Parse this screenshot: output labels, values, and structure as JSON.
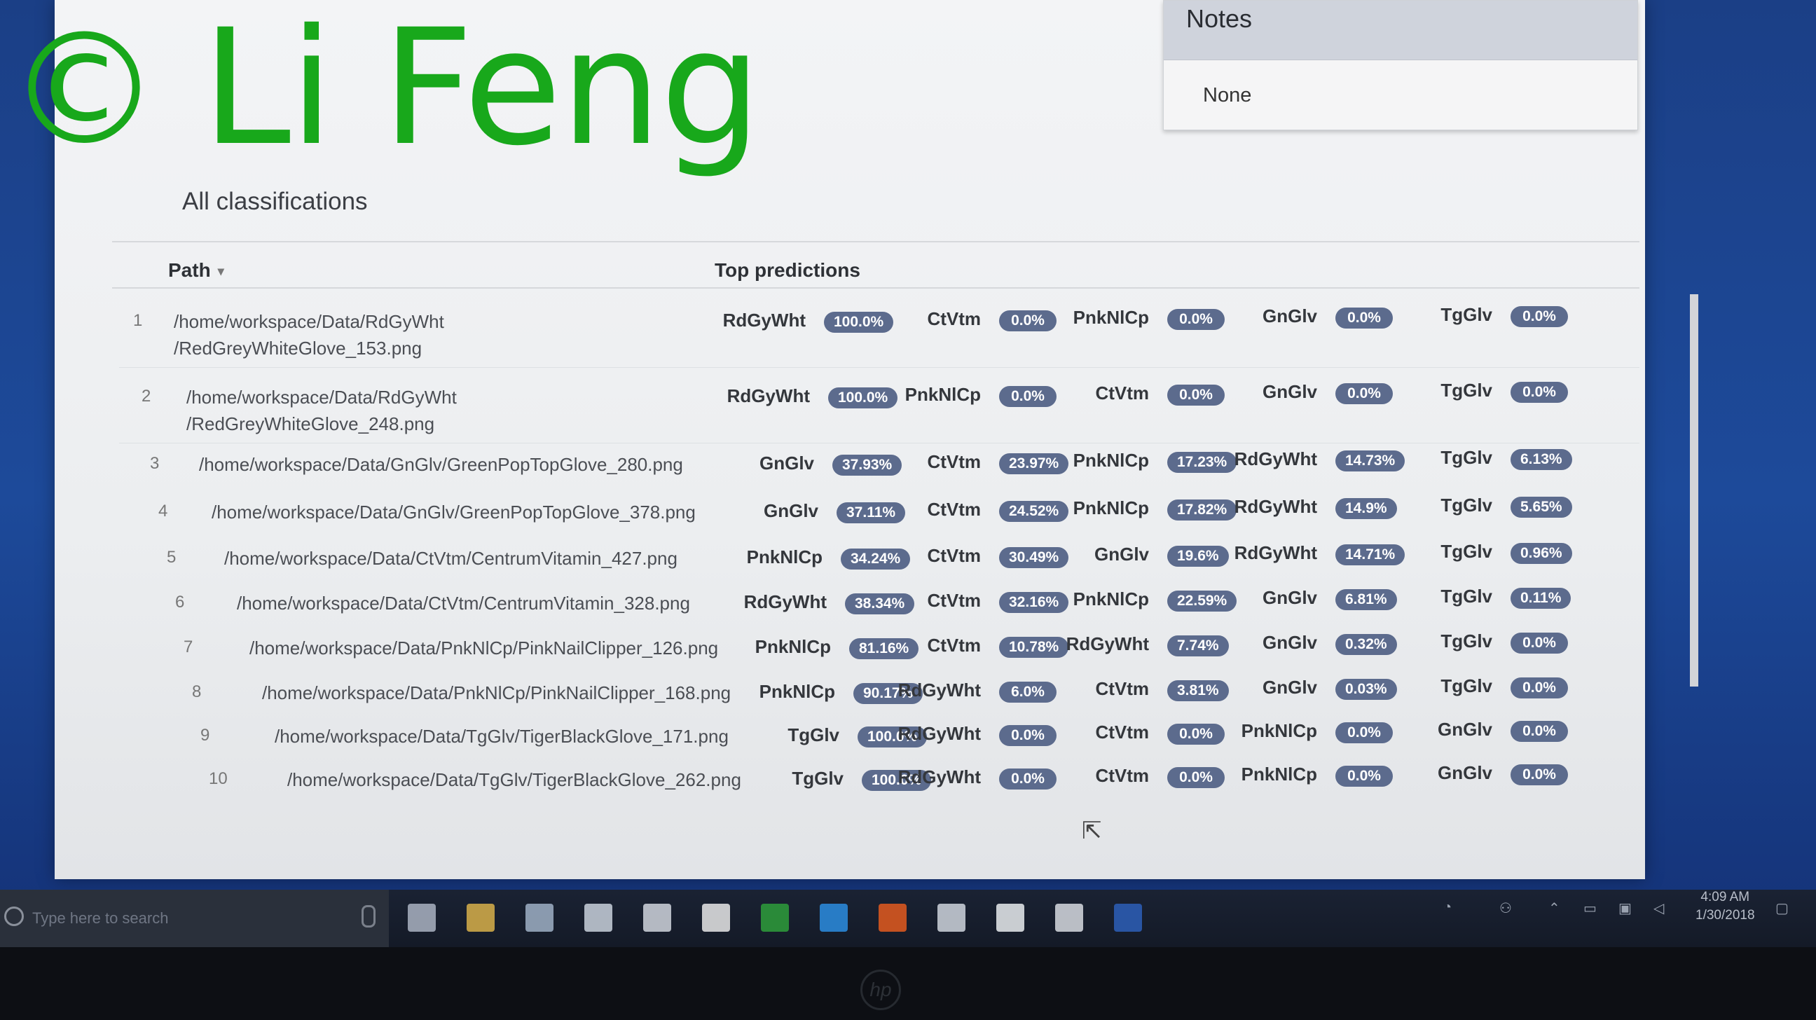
{
  "watermark": {
    "copyright": "©",
    "name": "Li Feng"
  },
  "notes": {
    "title": "Notes",
    "value": "None"
  },
  "section_title": "All classifications",
  "table": {
    "headers": {
      "path": "Path",
      "predictions": "Top predictions",
      "sort_icon": "sort-arrow-icon"
    },
    "rows": [
      {
        "num": "1",
        "path": [
          "/home/workspace/Data/RdGyWht",
          "/RedGreyWhiteGlove_153.png"
        ],
        "preds": [
          {
            "label": "RdGyWht",
            "value": "100.0%"
          },
          {
            "label": "CtVtm",
            "value": "0.0%"
          },
          {
            "label": "PnkNlCp",
            "value": "0.0%"
          },
          {
            "label": "GnGlv",
            "value": "0.0%"
          },
          {
            "label": "TgGlv",
            "value": "0.0%"
          }
        ]
      },
      {
        "num": "2",
        "path": [
          "/home/workspace/Data/RdGyWht",
          "/RedGreyWhiteGlove_248.png"
        ],
        "preds": [
          {
            "label": "RdGyWht",
            "value": "100.0%"
          },
          {
            "label": "PnkNlCp",
            "value": "0.0%"
          },
          {
            "label": "CtVtm",
            "value": "0.0%"
          },
          {
            "label": "GnGlv",
            "value": "0.0%"
          },
          {
            "label": "TgGlv",
            "value": "0.0%"
          }
        ]
      },
      {
        "num": "3",
        "path": [
          "/home/workspace/Data/GnGlv/GreenPopTopGlove_280.png"
        ],
        "preds": [
          {
            "label": "GnGlv",
            "value": "37.93%"
          },
          {
            "label": "CtVtm",
            "value": "23.97%"
          },
          {
            "label": "PnkNlCp",
            "value": "17.23%"
          },
          {
            "label": "RdGyWht",
            "value": "14.73%"
          },
          {
            "label": "TgGlv",
            "value": "6.13%"
          }
        ]
      },
      {
        "num": "4",
        "path": [
          "/home/workspace/Data/GnGlv/GreenPopTopGlove_378.png"
        ],
        "preds": [
          {
            "label": "GnGlv",
            "value": "37.11%"
          },
          {
            "label": "CtVtm",
            "value": "24.52%"
          },
          {
            "label": "PnkNlCp",
            "value": "17.82%"
          },
          {
            "label": "RdGyWht",
            "value": "14.9%"
          },
          {
            "label": "TgGlv",
            "value": "5.65%"
          }
        ]
      },
      {
        "num": "5",
        "path": [
          "/home/workspace/Data/CtVtm/CentrumVitamin_427.png"
        ],
        "preds": [
          {
            "label": "PnkNlCp",
            "value": "34.24%"
          },
          {
            "label": "CtVtm",
            "value": "30.49%"
          },
          {
            "label": "GnGlv",
            "value": "19.6%"
          },
          {
            "label": "RdGyWht",
            "value": "14.71%"
          },
          {
            "label": "TgGlv",
            "value": "0.96%"
          }
        ]
      },
      {
        "num": "6",
        "path": [
          "/home/workspace/Data/CtVtm/CentrumVitamin_328.png"
        ],
        "preds": [
          {
            "label": "RdGyWht",
            "value": "38.34%"
          },
          {
            "label": "CtVtm",
            "value": "32.16%"
          },
          {
            "label": "PnkNlCp",
            "value": "22.59%"
          },
          {
            "label": "GnGlv",
            "value": "6.81%"
          },
          {
            "label": "TgGlv",
            "value": "0.11%"
          }
        ]
      },
      {
        "num": "7",
        "path": [
          "/home/workspace/Data/PnkNlCp/PinkNailClipper_126.png"
        ],
        "preds": [
          {
            "label": "PnkNlCp",
            "value": "81.16%"
          },
          {
            "label": "CtVtm",
            "value": "10.78%"
          },
          {
            "label": "RdGyWht",
            "value": "7.74%"
          },
          {
            "label": "GnGlv",
            "value": "0.32%"
          },
          {
            "label": "TgGlv",
            "value": "0.0%"
          }
        ]
      },
      {
        "num": "8",
        "path": [
          "/home/workspace/Data/PnkNlCp/PinkNailClipper_168.png"
        ],
        "preds": [
          {
            "label": "PnkNlCp",
            "value": "90.17%"
          },
          {
            "label": "RdGyWht",
            "value": "6.0%"
          },
          {
            "label": "CtVtm",
            "value": "3.81%"
          },
          {
            "label": "GnGlv",
            "value": "0.03%"
          },
          {
            "label": "TgGlv",
            "value": "0.0%"
          }
        ]
      },
      {
        "num": "9",
        "path": [
          "/home/workspace/Data/TgGlv/TigerBlackGlove_171.png"
        ],
        "preds": [
          {
            "label": "TgGlv",
            "value": "100.0%"
          },
          {
            "label": "RdGyWht",
            "value": "0.0%"
          },
          {
            "label": "CtVtm",
            "value": "0.0%"
          },
          {
            "label": "PnkNlCp",
            "value": "0.0%"
          },
          {
            "label": "GnGlv",
            "value": "0.0%"
          }
        ]
      },
      {
        "num": "10",
        "path": [
          "/home/workspace/Data/TgGlv/TigerBlackGlove_262.png"
        ],
        "preds": [
          {
            "label": "TgGlv",
            "value": "100.0%"
          },
          {
            "label": "RdGyWht",
            "value": "0.0%"
          },
          {
            "label": "CtVtm",
            "value": "0.0%"
          },
          {
            "label": "PnkNlCp",
            "value": "0.0%"
          },
          {
            "label": "GnGlv",
            "value": "0.0%"
          }
        ]
      }
    ]
  },
  "taskbar": {
    "search_placeholder": "Type here to search",
    "clock_time": "4:09 AM",
    "clock_date": "1/30/2018",
    "apps": [
      "task-view-icon",
      "file-explorer-icon",
      "store-icon",
      "git-icon",
      "calculator-icon",
      "chrome-icon",
      "network-icon",
      "edge-icon",
      "firefox-icon",
      "image-viewer-icon",
      "document-icon",
      "pdf-icon",
      "word-icon"
    ]
  },
  "bezel": {
    "logo": "hp"
  },
  "colors": {
    "watermark": "#18a81b",
    "badge": "#5c6b8d",
    "taskbar": "#1a2233",
    "desktop": "#1d4a9a"
  }
}
